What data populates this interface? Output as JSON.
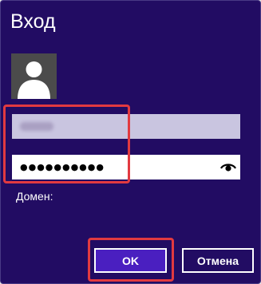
{
  "dialog": {
    "title": "Вход",
    "avatar_icon": "user-silhouette-icon",
    "username": {
      "value": "",
      "obscured": true
    },
    "password": {
      "masked_value": "●●●●●●●●●●",
      "reveal_icon": "eye-icon"
    },
    "domain_label": "Домен:",
    "buttons": {
      "ok_label": "OK",
      "cancel_label": "Отмена"
    }
  },
  "colors": {
    "background": "#220c63",
    "username_field": "#c9c5e0",
    "password_field": "#ffffff",
    "ok_button": "#4a1fc0",
    "highlight": "#e23a40"
  }
}
